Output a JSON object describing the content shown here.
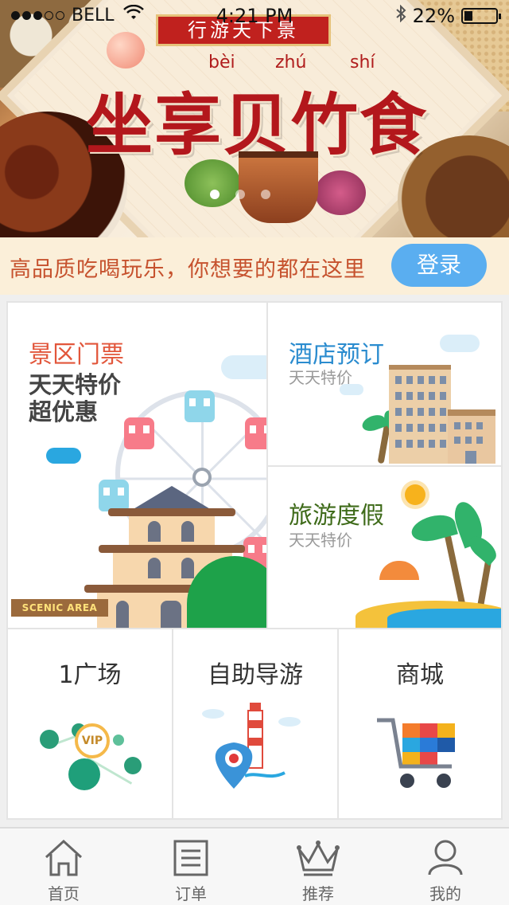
{
  "status_bar": {
    "carrier": "BELL",
    "time": "4:21 PM",
    "battery": "22%"
  },
  "banner": {
    "tag": "行游天下景",
    "pinyin": [
      "bèi",
      "zhú",
      "shí"
    ],
    "headline": "坐享贝竹食",
    "page_count": 3,
    "active_page": 1
  },
  "promo": {
    "text": "高品质吃喝玩乐，你想要的都在这里",
    "login_label": "登录"
  },
  "cards": {
    "scenic": {
      "title": "景区门票",
      "subtitle1": "天天特价",
      "subtitle2": "超优惠",
      "sign": "SCENIC AREA"
    },
    "hotel": {
      "title": "酒店预订",
      "subtitle": "天天特价"
    },
    "travel": {
      "title": "旅游度假",
      "subtitle": "天天特价"
    },
    "square": {
      "title": "1广场",
      "badge": "VIP"
    },
    "guide": {
      "title": "自助导游"
    },
    "mall": {
      "title": "商城"
    }
  },
  "tabbar": {
    "items": [
      {
        "label": "首页",
        "icon": "home-icon"
      },
      {
        "label": "订单",
        "icon": "list-icon"
      },
      {
        "label": "推荐",
        "icon": "crown-icon"
      },
      {
        "label": "我的",
        "icon": "user-icon"
      }
    ]
  },
  "colors": {
    "scenic_title": "#e2563b",
    "hotel_title": "#2b8ccf",
    "travel_title": "#3f6b1a",
    "login_button": "#5aaef0",
    "promo_text": "#c6522e",
    "promo_bg": "#fbefd9"
  }
}
